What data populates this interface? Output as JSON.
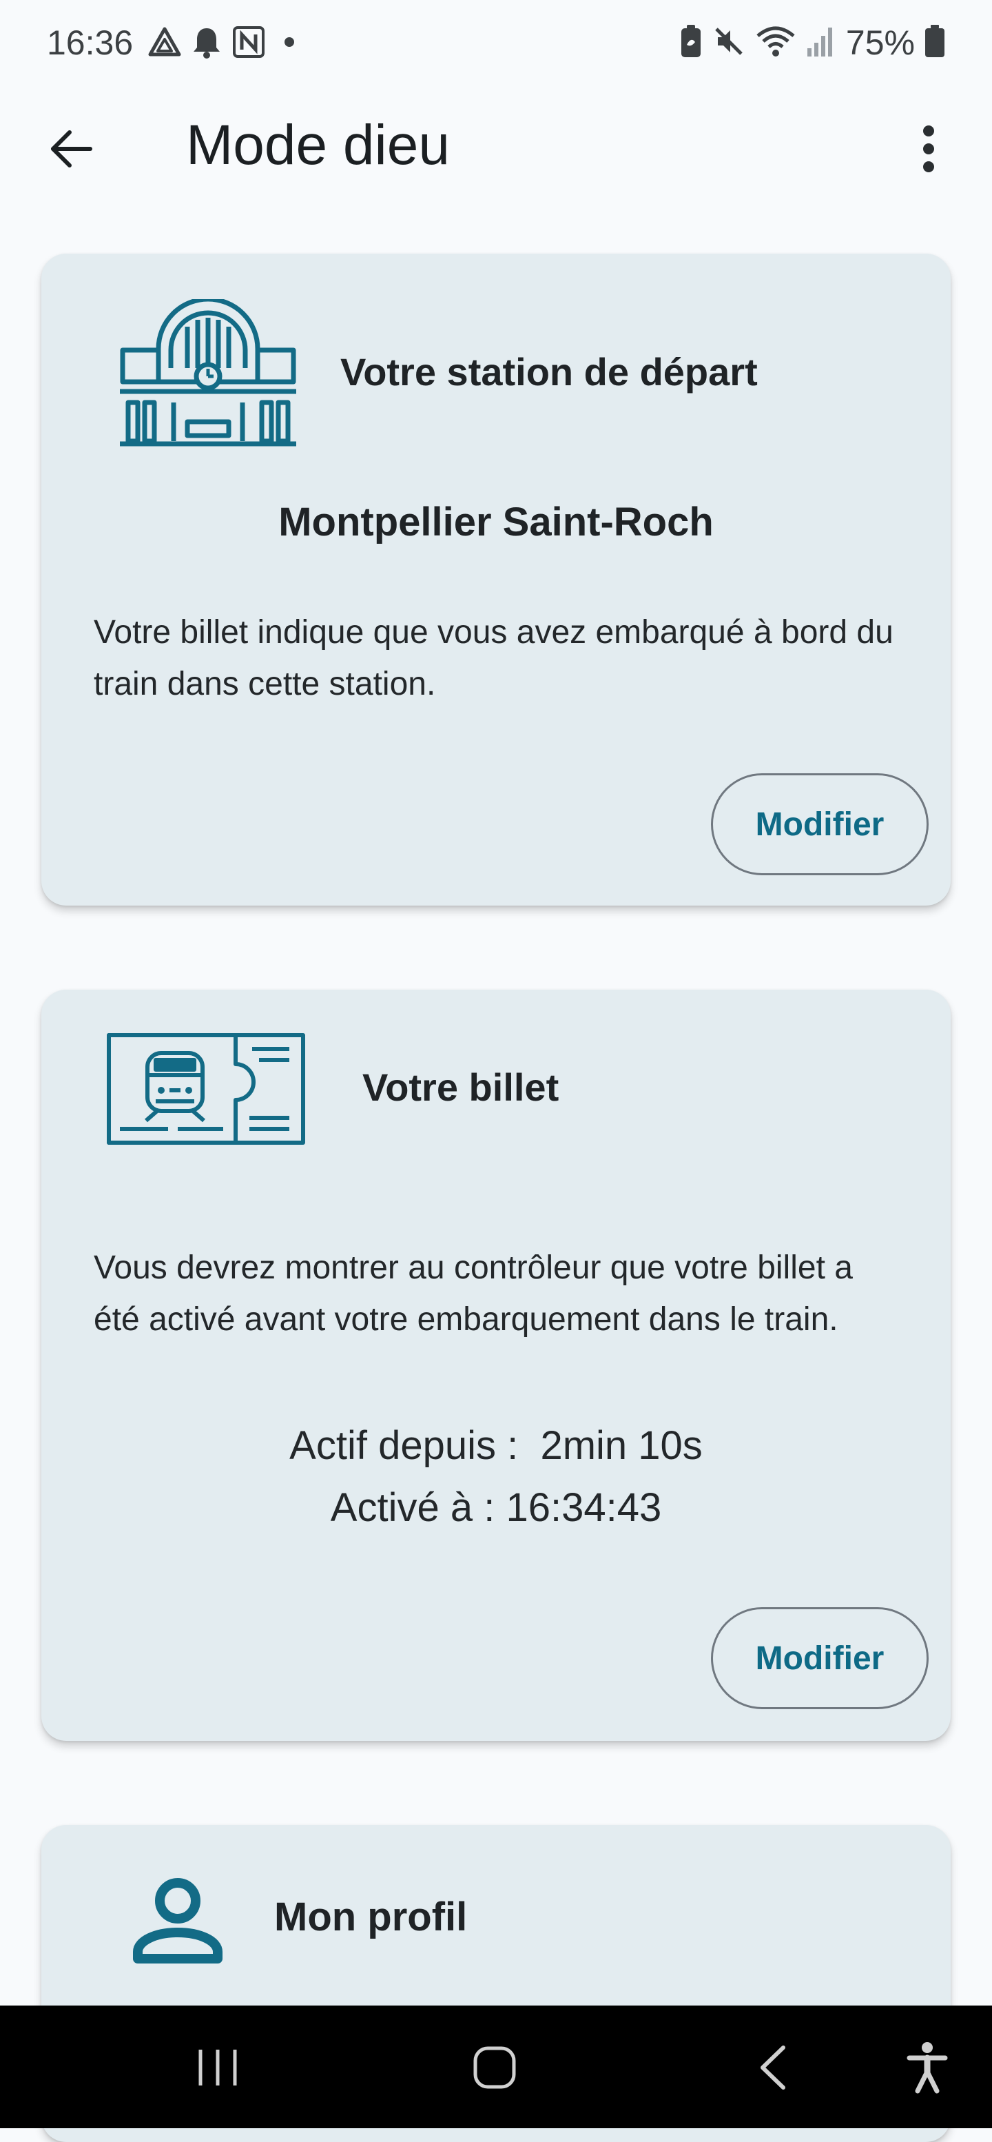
{
  "status_bar": {
    "time": "16:36",
    "battery": "75%",
    "left_icons": [
      "drive-icon",
      "bell-icon",
      "notion-icon",
      "dot-icon"
    ],
    "right_icons": [
      "battery-saver-icon",
      "mute-icon",
      "wifi-icon",
      "signal-icon",
      "battery-icon"
    ]
  },
  "app_bar": {
    "title": "Mode dieu"
  },
  "station_card": {
    "title": "Votre station de départ",
    "station": "Montpellier Saint-Roch",
    "description": "Votre billet indique que vous avez embarqué à bord du train dans cette station.",
    "button": "Modifier"
  },
  "ticket_card": {
    "title": "Votre billet",
    "description": "Vous devrez montrer au contrôleur que votre billet a été activé avant votre embarquement dans le train.",
    "active_since": "Actif depuis :  2min 10s",
    "activated_at": "Activé à : 16:34:43",
    "button": "Modifier"
  },
  "profile_card": {
    "title": "Mon profil"
  },
  "colors": {
    "accent": "#0e6a86",
    "card_bg": "#e3ecf0",
    "page_bg": "#f8fafc"
  }
}
